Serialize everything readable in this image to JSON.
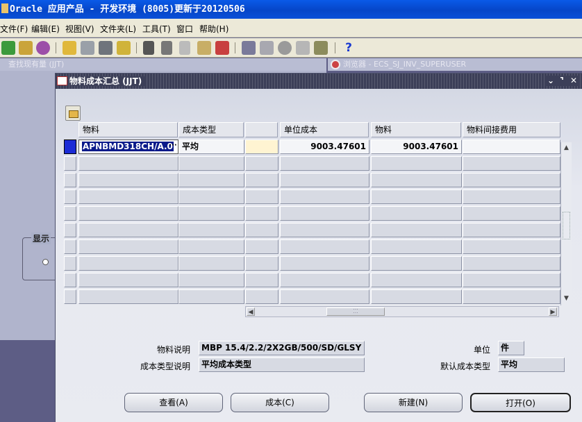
{
  "window": {
    "title": "Oracle 应用产品 - 开发环境 (8005)更新于20120506"
  },
  "menubar": [
    {
      "label": "文件(F)"
    },
    {
      "label": "编辑(E)"
    },
    {
      "label": "视图(V)"
    },
    {
      "label": "文件夹(L)"
    },
    {
      "label": "工具(T)"
    },
    {
      "label": "窗口"
    },
    {
      "label": "帮助(H)"
    }
  ],
  "toolbar": {
    "icons": [
      "new-icon",
      "flashlight-icon",
      "navigator-icon",
      "save-icon",
      "print-setup-icon",
      "print-icon",
      "attach-folder-icon",
      "cut-icon",
      "copy-icon",
      "paste-icon",
      "edit-icon",
      "delete-icon",
      "pencil-icon",
      "translate-icon",
      "circle-icon",
      "paperclip-icon",
      "tools-icon",
      "help-icon"
    ]
  },
  "background": {
    "find_window_title": "查找现有量 (JJT)",
    "navigator_title": "浏览器 - ECS_SJ_INV_SUPERUSER",
    "display_group_label": "显示"
  },
  "form": {
    "title": "物料成本汇总 (JJT)",
    "columns": {
      "item": "物料",
      "cost_type": "成本类型",
      "blank": "",
      "unit_cost": "单位成本",
      "material": "物料",
      "material_overhead": "物料间接费用"
    },
    "rows": [
      {
        "item": "APNBMD318CH/A.0",
        "cost_type": "平均",
        "unit_cost": "9003.47601",
        "material": "9003.47601",
        "material_overhead": ""
      },
      {
        "item": "",
        "cost_type": "",
        "unit_cost": "",
        "material": "",
        "material_overhead": ""
      },
      {
        "item": "",
        "cost_type": "",
        "unit_cost": "",
        "material": "",
        "material_overhead": ""
      },
      {
        "item": "",
        "cost_type": "",
        "unit_cost": "",
        "material": "",
        "material_overhead": ""
      },
      {
        "item": "",
        "cost_type": "",
        "unit_cost": "",
        "material": "",
        "material_overhead": ""
      },
      {
        "item": "",
        "cost_type": "",
        "unit_cost": "",
        "material": "",
        "material_overhead": ""
      },
      {
        "item": "",
        "cost_type": "",
        "unit_cost": "",
        "material": "",
        "material_overhead": ""
      },
      {
        "item": "",
        "cost_type": "",
        "unit_cost": "",
        "material": "",
        "material_overhead": ""
      },
      {
        "item": "",
        "cost_type": "",
        "unit_cost": "",
        "material": "",
        "material_overhead": ""
      },
      {
        "item": "",
        "cost_type": "",
        "unit_cost": "",
        "material": "",
        "material_overhead": ""
      }
    ],
    "details": {
      "item_desc_label": "物料说明",
      "item_desc": "MBP 15.4/2.2/2X2GB/500/SD/GLSY",
      "cost_type_desc_label": "成本类型说明",
      "cost_type_desc": "平均成本类型",
      "uom_label": "单位",
      "uom": "件",
      "default_cost_type_label": "默认成本类型",
      "default_cost_type": "平均"
    },
    "buttons": {
      "view": "查看(A)",
      "cost": "成本(C)",
      "new": "新建(N)",
      "open": "打开(O)"
    }
  },
  "colors": {
    "titlebar": "#0646c8",
    "form_title": "#3c3f58",
    "current_record": "#1b2bd6",
    "selection": "#0a1a8a"
  }
}
